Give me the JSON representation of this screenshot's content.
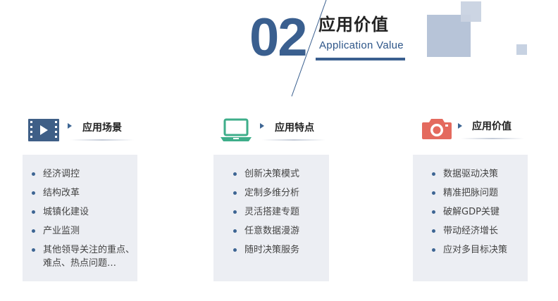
{
  "header": {
    "number": "02",
    "title_cn": "应用价值",
    "title_en": "Application  Value"
  },
  "columns": [
    {
      "title": "应用场景",
      "icon": "video-icon",
      "items": [
        "经济调控",
        "结构改革",
        "城镇化建设",
        "产业监测",
        "其他领导关注的重点、难点、热点问题…"
      ]
    },
    {
      "title": "应用特点",
      "icon": "laptop-icon",
      "items": [
        "创新决策模式",
        "定制多维分析",
        "灵活搭建专题",
        "任意数据漫游",
        "随时决策服务"
      ]
    },
    {
      "title": "应用价值",
      "icon": "camera-icon",
      "items": [
        "数据驱动决策",
        "精准把脉问题",
        "破解GDP关键",
        "带动经济增长",
        "应对多目标决策"
      ]
    }
  ],
  "colors": {
    "accent_blue": "#3a5f8f",
    "icon_video": "#3f5f87",
    "icon_laptop": "#3eae8a",
    "icon_camera": "#e46a5e",
    "box_bg": "#eceef3"
  }
}
